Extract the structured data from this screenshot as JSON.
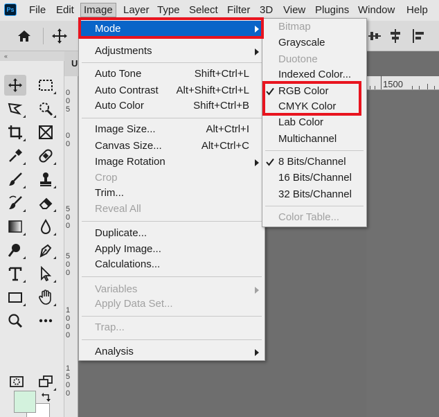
{
  "app": {
    "logo": "Ps"
  },
  "menubar": {
    "items": [
      {
        "label": "File"
      },
      {
        "label": "Edit"
      },
      {
        "label": "Image"
      },
      {
        "label": "Layer"
      },
      {
        "label": "Type"
      },
      {
        "label": "Select"
      },
      {
        "label": "Filter"
      },
      {
        "label": "3D"
      },
      {
        "label": "View"
      },
      {
        "label": "Plugins"
      },
      {
        "label": "Window"
      },
      {
        "label": "Help"
      }
    ]
  },
  "toolbox": {
    "collapse_label": "«"
  },
  "document": {
    "tab_label": "U"
  },
  "rulers": {
    "vertical": [
      "0",
      "0",
      "5",
      "0",
      "0",
      "5",
      "0",
      "0",
      "5",
      "0",
      "0",
      "1",
      "0",
      "0",
      "0",
      "1",
      "5",
      "0",
      "0"
    ],
    "horizontal": "1500"
  },
  "colors": {
    "foreground": "#d3f2dd",
    "background": "#ffffff",
    "highlight": "#0a64c8",
    "annotation": "#e8141f"
  },
  "image_menu": {
    "items": [
      {
        "label": "Mode",
        "submenu": true,
        "highlighted": true
      },
      {
        "label": "Adjustments",
        "submenu": true
      },
      {
        "label": "Auto Tone",
        "shortcut": "Shift+Ctrl+L"
      },
      {
        "label": "Auto Contrast",
        "shortcut": "Alt+Shift+Ctrl+L"
      },
      {
        "label": "Auto Color",
        "shortcut": "Shift+Ctrl+B"
      },
      {
        "label": "Image Size...",
        "shortcut": "Alt+Ctrl+I"
      },
      {
        "label": "Canvas Size...",
        "shortcut": "Alt+Ctrl+C"
      },
      {
        "label": "Image Rotation",
        "submenu": true
      },
      {
        "label": "Crop",
        "disabled": true
      },
      {
        "label": "Trim..."
      },
      {
        "label": "Reveal All",
        "disabled": true
      },
      {
        "label": "Duplicate..."
      },
      {
        "label": "Apply Image..."
      },
      {
        "label": "Calculations..."
      },
      {
        "label": "Variables",
        "submenu": true,
        "disabled": true
      },
      {
        "label": "Apply Data Set...",
        "disabled": true
      },
      {
        "label": "Trap...",
        "disabled": true
      },
      {
        "label": "Analysis",
        "submenu": true
      }
    ]
  },
  "mode_submenu": {
    "items": [
      {
        "label": "Bitmap",
        "disabled": true
      },
      {
        "label": "Grayscale"
      },
      {
        "label": "Duotone",
        "disabled": true
      },
      {
        "label": "Indexed Color..."
      },
      {
        "label": "RGB Color",
        "checked": true
      },
      {
        "label": "CMYK Color"
      },
      {
        "label": "Lab Color"
      },
      {
        "label": "Multichannel"
      },
      {
        "label": "8 Bits/Channel",
        "checked": true
      },
      {
        "label": "16 Bits/Channel"
      },
      {
        "label": "32 Bits/Channel"
      },
      {
        "label": "Color Table...",
        "disabled": true
      }
    ]
  }
}
